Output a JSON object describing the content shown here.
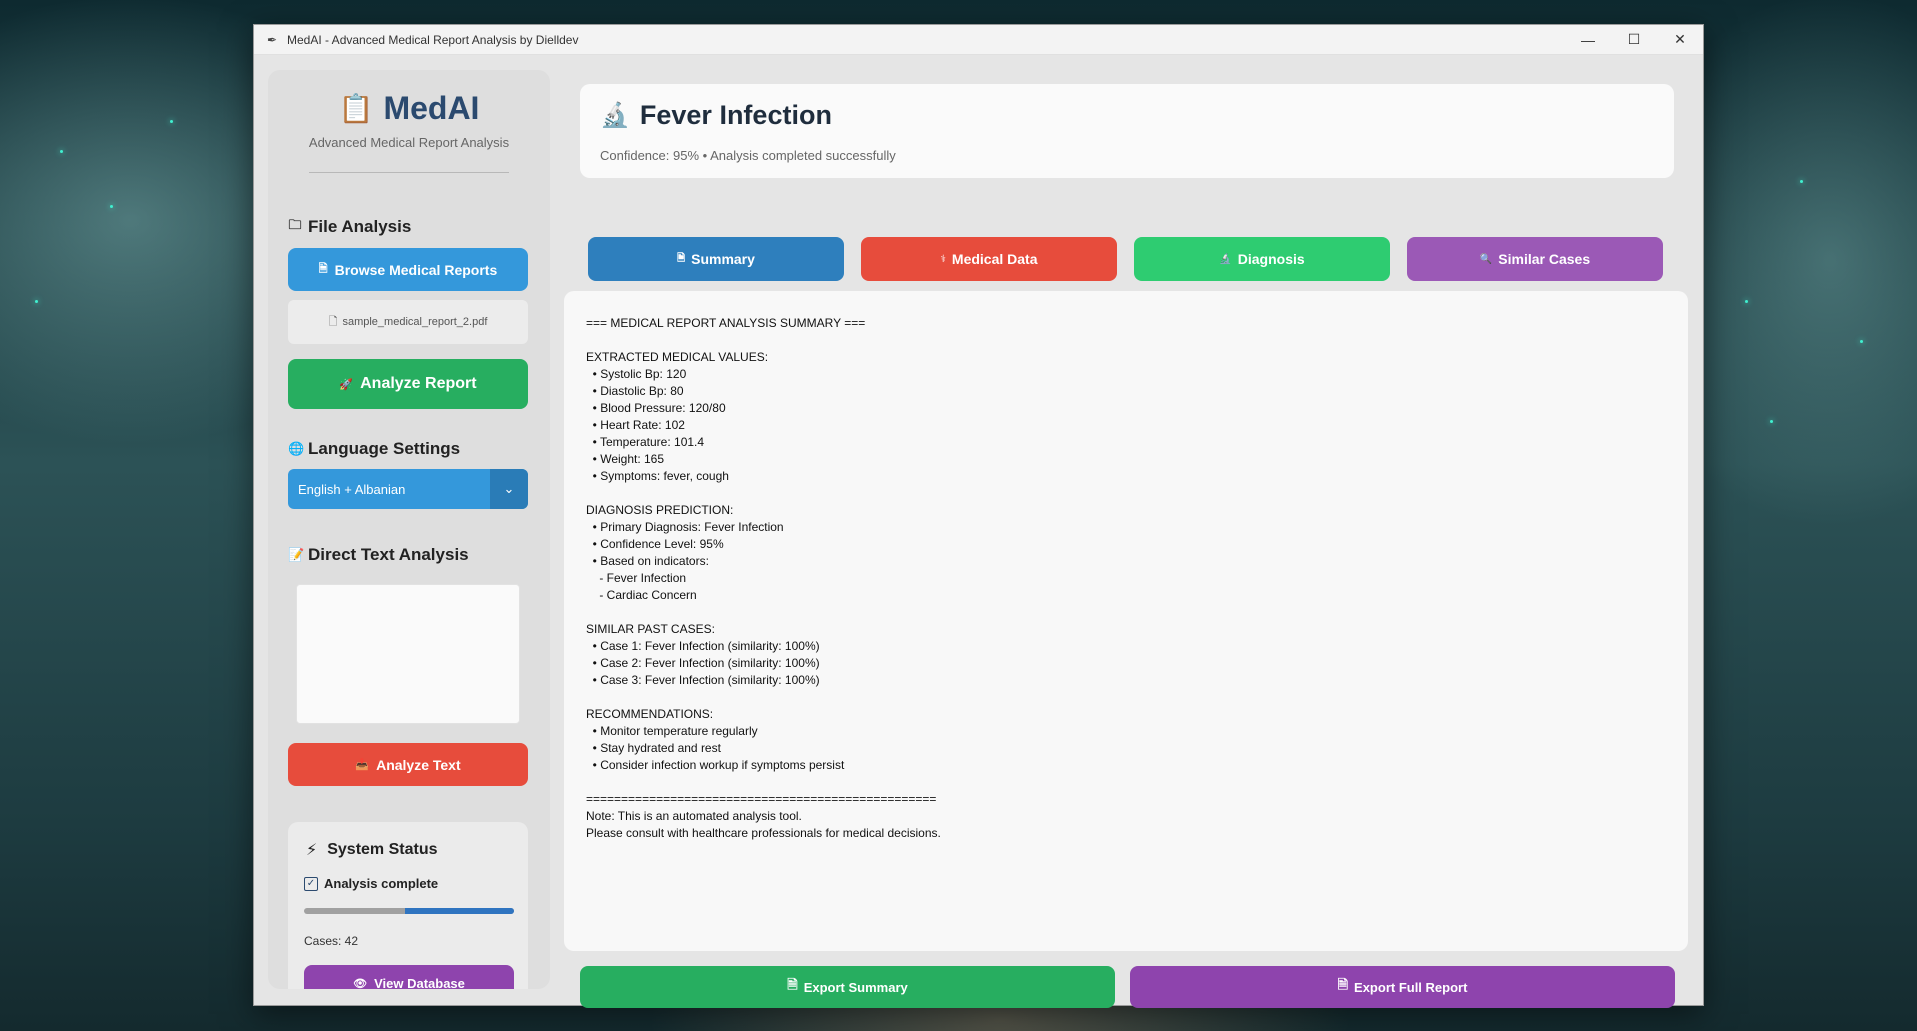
{
  "window": {
    "title": "MedAI - Advanced Medical Report Analysis by Dielldev",
    "controls": {
      "minimize": "—",
      "maximize": "☐",
      "close": "✕"
    }
  },
  "sidebar": {
    "logo_title": "MedAI",
    "logo_subtitle": "Advanced Medical Report Analysis",
    "file_analysis": {
      "title": "File Analysis",
      "browse_button": "Browse Medical Reports",
      "file_name": "sample_medical_report_2.pdf",
      "analyze_button": "Analyze Report"
    },
    "language": {
      "title": "Language Settings",
      "selected": "English + Albanian"
    },
    "direct_text": {
      "title": "Direct Text Analysis",
      "textarea_value": "",
      "analyze_button": "Analyze Text"
    },
    "status": {
      "title": "System Status",
      "state": "Analysis complete",
      "progress": 0.52,
      "cases": "Cases: 42",
      "database_button": "View Database"
    }
  },
  "header": {
    "title": "Fever Infection",
    "subtitle": "Confidence: 95% • Analysis completed successfully"
  },
  "tabs": [
    {
      "label": "Summary",
      "icon": "document-icon",
      "color": "#2e7fbd"
    },
    {
      "label": "Medical Data",
      "icon": "stethoscope-icon",
      "color": "#e74c3c"
    },
    {
      "label": "Diagnosis",
      "icon": "microscope-icon",
      "color": "#2ecc71"
    },
    {
      "label": "Similar Cases",
      "icon": "magnifier-icon",
      "color": "#9b59b6"
    }
  ],
  "report_text": "=== MEDICAL REPORT ANALYSIS SUMMARY ===\n\nEXTRACTED MEDICAL VALUES:\n  • Systolic Bp: 120\n  • Diastolic Bp: 80\n  • Blood Pressure: 120/80\n  • Heart Rate: 102\n  • Temperature: 101.4\n  • Weight: 165\n  • Symptoms: fever, cough\n\nDIAGNOSIS PREDICTION:\n  • Primary Diagnosis: Fever Infection\n  • Confidence Level: 95%\n  • Based on indicators:\n    - Fever Infection\n    - Cardiac Concern\n\nSIMILAR PAST CASES:\n  • Case 1: Fever Infection (similarity: 100%)\n  • Case 2: Fever Infection (similarity: 100%)\n  • Case 3: Fever Infection (similarity: 100%)\n\nRECOMMENDATIONS:\n  • Monitor temperature regularly\n  • Stay hydrated and rest\n  • Consider infection workup if symptoms persist\n\n==================================================\nNote: This is an automated analysis tool.\nPlease consult with healthcare professionals for medical decisions.",
  "exports": {
    "summary": "Export Summary",
    "full_report": "Export Full Report"
  },
  "colors": {
    "blue": "#3498db",
    "green": "#27ae60",
    "red": "#e74c3c",
    "purple": "#8e44ad",
    "title": "#2b4a6f"
  }
}
